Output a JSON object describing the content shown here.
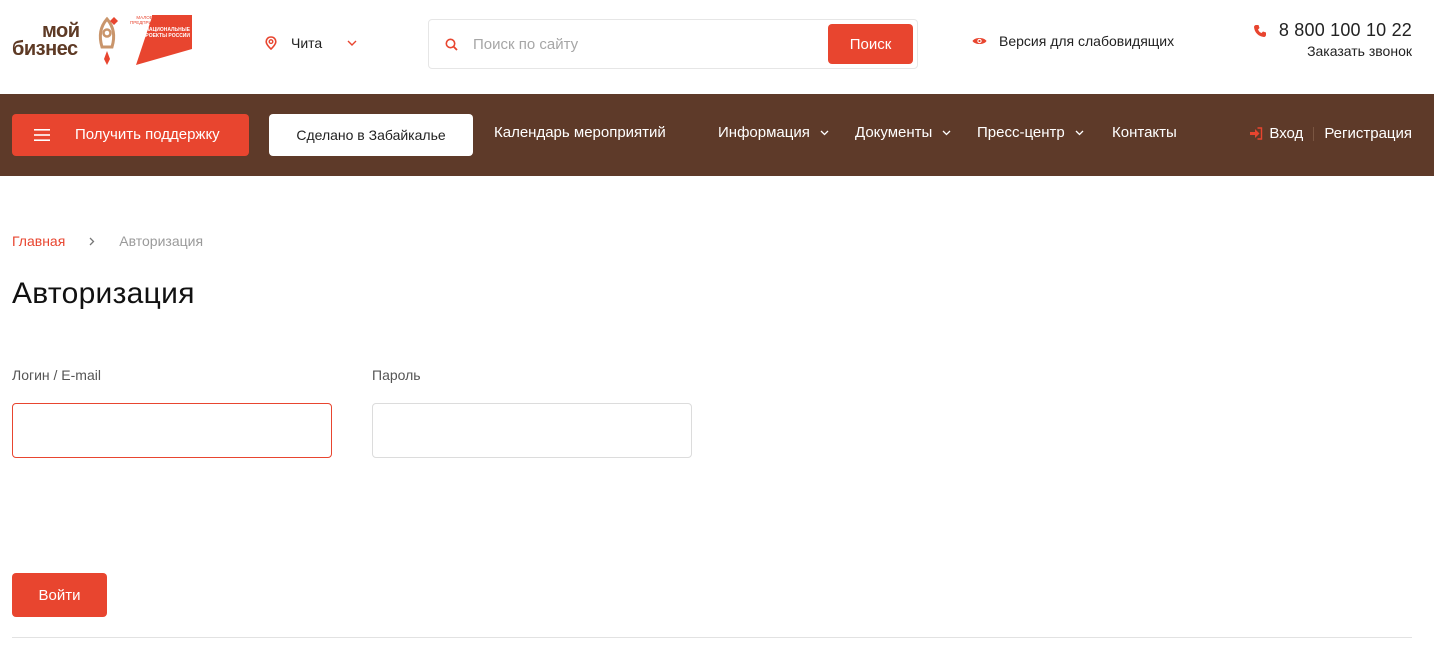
{
  "colors": {
    "accent": "#e8452f",
    "brand_brown": "#5e3a29",
    "nav_text": "#ffffff"
  },
  "header": {
    "logo": {
      "word1": "мой",
      "word2": "бизнес",
      "flag_top": "МАЛОЕ И СРЕДНЕЕ ПРЕДПРИНИМАТЕЛЬСТВО",
      "flag_text": "НАЦИОНАЛЬНЫЕ ПРОЕКТЫ РОССИИ",
      "icons": [
        "rocket-icon",
        "national-projects-flag"
      ]
    },
    "city": {
      "icon": "location-pin-icon",
      "name": "Чита",
      "dropdown_icon": "chevron-down-icon"
    },
    "search": {
      "icon": "search-icon",
      "placeholder": "Поиск по сайту",
      "value": "",
      "button_label": "Поиск"
    },
    "vision": {
      "icon": "eye-icon",
      "label": "Версия для слабовидящих"
    },
    "contact": {
      "icon": "phone-icon",
      "phone": "8 800 100 10 22",
      "callback_label": "Заказать звонок"
    }
  },
  "nav": {
    "support_button": {
      "icon": "menu-icon",
      "label": "Получить поддержку"
    },
    "made_button": {
      "label": "Сделано в Забайкалье"
    },
    "links": [
      {
        "label": "Календарь мероприятий",
        "has_dropdown": false
      },
      {
        "label": "Информация",
        "has_dropdown": true
      },
      {
        "label": "Документы",
        "has_dropdown": true
      },
      {
        "label": "Пресс-центр",
        "has_dropdown": true
      },
      {
        "label": "Контакты",
        "has_dropdown": false
      }
    ],
    "auth": {
      "login_icon": "sign-in-icon",
      "login_label": "Вход",
      "register_label": "Регистрация"
    }
  },
  "breadcrumb": {
    "home": "Главная",
    "separator_icon": "chevron-right-icon",
    "current": "Авторизация"
  },
  "page": {
    "title": "Авторизация",
    "form": {
      "login_label": "Логин / E-mail",
      "login_value": "",
      "password_label": "Пароль",
      "password_value": "",
      "submit_label": "Войти"
    }
  }
}
